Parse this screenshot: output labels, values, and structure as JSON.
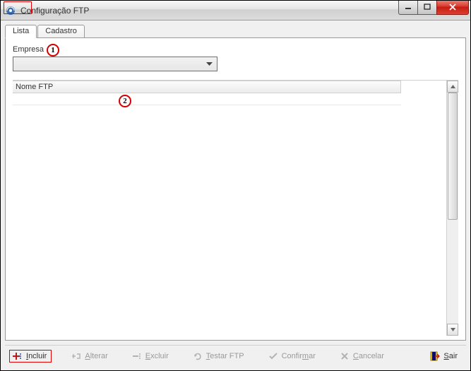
{
  "window": {
    "title": "Configuração FTP"
  },
  "tabs": [
    {
      "label": "Lista",
      "active": true
    },
    {
      "label": "Cadastro",
      "active": false
    }
  ],
  "filter": {
    "empresa_label": "Empresa",
    "empresa_value": ""
  },
  "grid": {
    "columns": [
      {
        "label": "Nome FTP"
      }
    ],
    "rows": []
  },
  "toolbar": {
    "incluir": "Incluir",
    "alterar": "Alterar",
    "excluir": "Excluir",
    "testar": "Testar FTP",
    "confirmar": "Confirmar",
    "cancelar": "Cancelar",
    "sair": "Sair"
  },
  "annotations": {
    "a1": "1",
    "a2": "2"
  }
}
